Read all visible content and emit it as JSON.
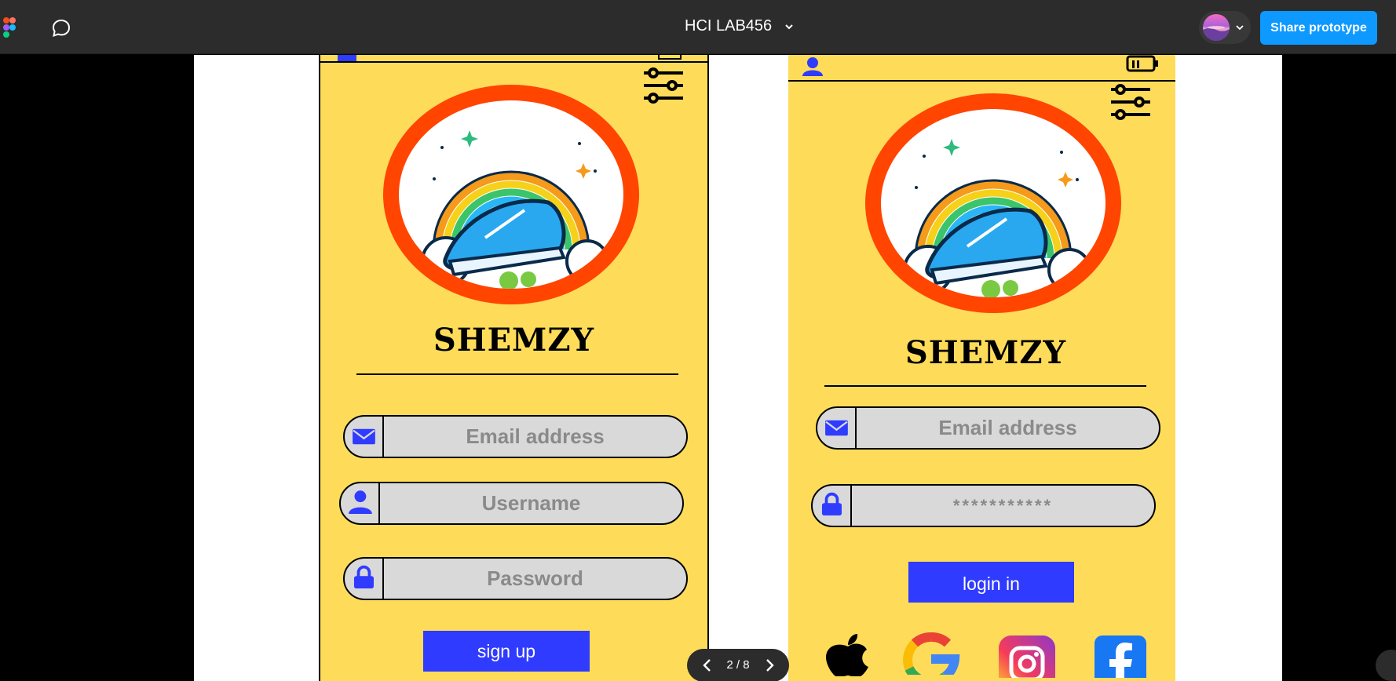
{
  "toolbar": {
    "file_title": "HCI LAB456",
    "share_label": "Share prototype"
  },
  "pager": {
    "text": "2 / 8"
  },
  "signup_screen": {
    "brand": "SHEMZY",
    "email_placeholder": "Email address",
    "username_placeholder": "Username",
    "password_placeholder": "Password",
    "button_label": "sign up"
  },
  "login_screen": {
    "brand": "SHEMZY",
    "email_placeholder": "Email address",
    "password_placeholder": "***********",
    "button_label": "login in"
  },
  "colors": {
    "screen_bg": "#fedc5a",
    "accent_blue": "#2f3bff",
    "logo_ring": "#ff4500",
    "field_bg": "#d9d9d9"
  },
  "icons": [
    "figma-logo-icon",
    "comment-icon",
    "chevron-down-icon",
    "settings-sliders-icon",
    "mail-icon",
    "user-icon",
    "lock-icon",
    "battery-icon",
    "apple-icon",
    "google-icon",
    "instagram-icon",
    "facebook-icon",
    "chevron-left-icon",
    "chevron-right-icon"
  ]
}
